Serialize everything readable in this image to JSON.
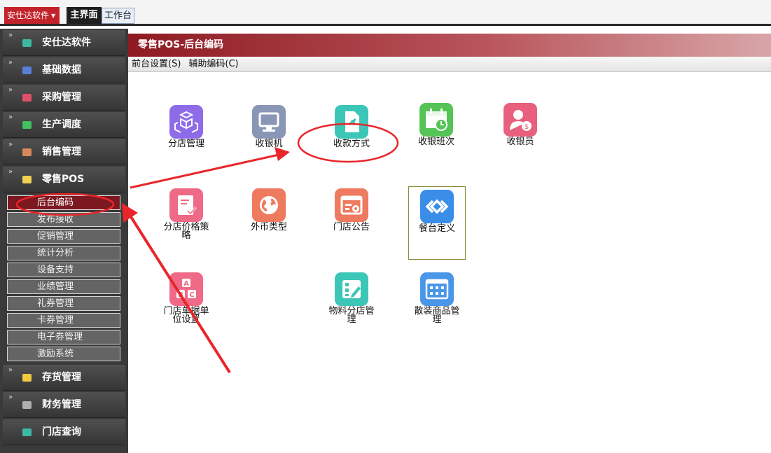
{
  "header": {
    "app_menu": "安仕达软件",
    "tabs": [
      "主界面",
      "工作台"
    ]
  },
  "sidebar": {
    "modules": [
      {
        "label": "安仕达软件",
        "icon": "teal-cube-icon",
        "color": "#3db8a2"
      },
      {
        "label": "基础数据",
        "icon": "blue-database-icon",
        "color": "#5a7fd6"
      },
      {
        "label": "采购管理",
        "icon": "red-cart-icon",
        "color": "#e0506a"
      },
      {
        "label": "生产调度",
        "icon": "green-factory-icon",
        "color": "#40c060"
      },
      {
        "label": "销售管理",
        "icon": "orange-sales-icon",
        "color": "#d8885a"
      },
      {
        "label": "零售POS",
        "icon": "yellow-pos-icon",
        "color": "#f0d050"
      }
    ],
    "subitems": [
      "后台编码",
      "发布接收",
      "促销管理",
      "统计分析",
      "设备支持",
      "业绩管理",
      "礼券管理",
      "卡券管理",
      "电子券管理",
      "激励系统"
    ],
    "active_subitem": "后台编码",
    "modules_after": [
      {
        "label": "存货管理",
        "icon": "yellow-stock-icon",
        "color": "#f0c840"
      },
      {
        "label": "财务管理",
        "icon": "gray-finance-icon",
        "color": "#b0b0b0"
      },
      {
        "label": "门店查询",
        "icon": "teal-store-icon",
        "color": "#3db8a2"
      }
    ]
  },
  "main": {
    "title": "零售POS-后台编码",
    "menu": [
      "前台设置(S)",
      "辅助编码(C)"
    ],
    "tiles": [
      {
        "label": "分店管理",
        "icon": "boxes-icon",
        "color": "#8e6ce8"
      },
      {
        "label": "收银机",
        "icon": "monitor-icon",
        "color": "#8a96b6"
      },
      {
        "label": "收款方式",
        "icon": "payment-document-icon",
        "color": "#3cc6b8"
      },
      {
        "label": "收银班次",
        "icon": "calendar-clock-icon",
        "color": "#55c456"
      },
      {
        "label": "收银员",
        "icon": "cashier-user-icon",
        "color": "#e8607e"
      },
      {
        "label": "分店价格策略",
        "icon": "price-strategy-icon",
        "color": "#ee6a86"
      },
      {
        "label": "外币类型",
        "icon": "globe-icon",
        "color": "#ee7a60"
      },
      {
        "label": "门店公告",
        "icon": "announcement-icon",
        "color": "#ee7a60"
      },
      {
        "label": "餐台定义",
        "icon": "table-definition-icon",
        "color": "#3a8ee8"
      },
      {
        "label": "门店单据单位设置",
        "icon": "abc-units-icon",
        "color": "#ee6a86"
      },
      {
        "label": "物料分店管理",
        "icon": "edit-grid-icon",
        "color": "#3cc6b8"
      },
      {
        "label": "散装商品管理",
        "icon": "calculator-grid-icon",
        "color": "#4a96e8"
      }
    ]
  },
  "annotation": {
    "color": "#e8262b"
  }
}
